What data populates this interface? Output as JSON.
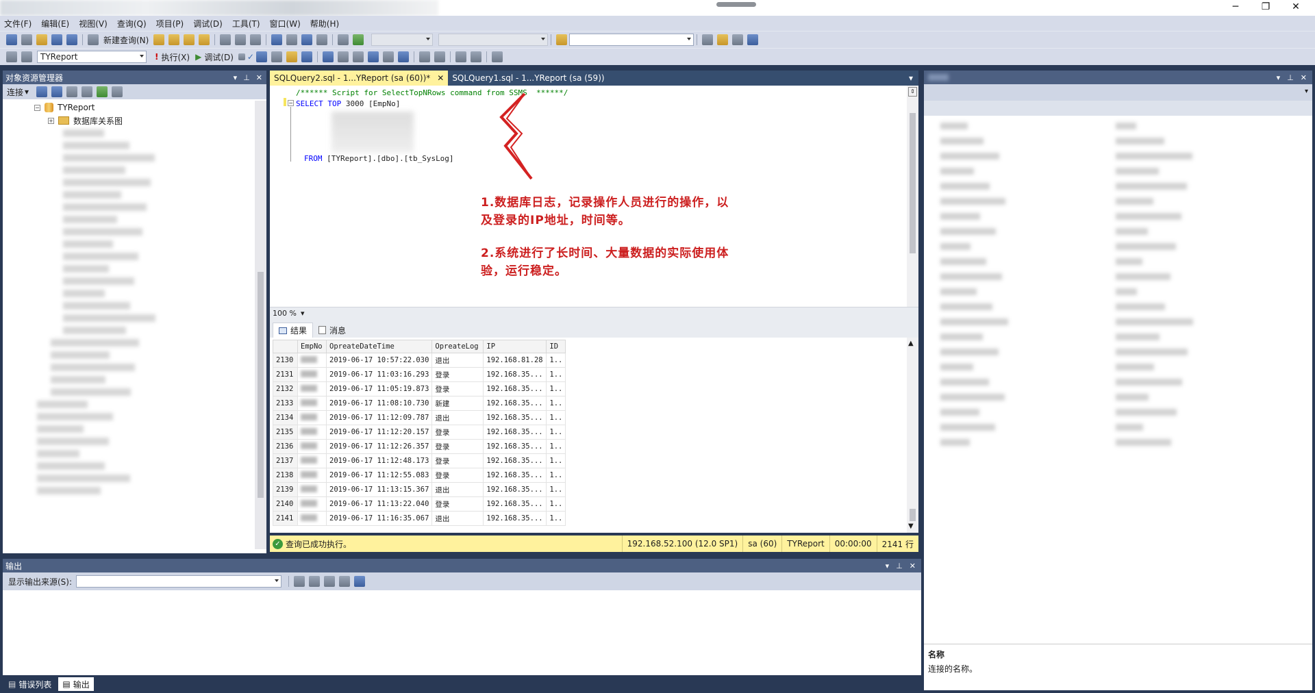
{
  "window": {
    "min_icon": "minimize-icon",
    "max_icon": "restore-icon",
    "close_icon": "close-icon",
    "min_glyph": "─",
    "max_glyph": "❐",
    "close_glyph": "✕"
  },
  "menu": [
    "文件(F)",
    "编辑(E)",
    "视图(V)",
    "查询(Q)",
    "项目(P)",
    "调试(D)",
    "工具(T)",
    "窗口(W)",
    "帮助(H)"
  ],
  "toolbar": {
    "new_query": "新建查询(N)",
    "database": "TYReport",
    "execute": "执行(X)",
    "debug": "调试(D)"
  },
  "object_explorer": {
    "title": "对象资源管理器",
    "connect": "连接",
    "db_name": "TYReport",
    "diagrams": "数据库关系图"
  },
  "tabs": [
    {
      "label": "SQLQuery2.sql - 1...YReport (sa (60))*",
      "active": true
    },
    {
      "label": "SQLQuery1.sql - 1...YReport (sa (59))",
      "active": false
    }
  ],
  "editor": {
    "line1": "/****** Script for SelectTopNRows command from SSMS  ******/",
    "line2_kw": "SELECT TOP",
    "line2_rest": " 3000 [EmpNo]",
    "line_from_kw": "FROM",
    "line_from_rest": " [TYReport].[dbo].[tb_SysLog]"
  },
  "annotation": {
    "p1_line1": "1.数据库日志，记录操作人员进行的操作，以",
    "p1_line2": "及登录的IP地址，时间等。",
    "p2_line1": "2.系统进行了长时间、大量数据的实际使用体",
    "p2_line2": "验，运行稳定。"
  },
  "zoom": "100 %",
  "results": {
    "tab_results": "结果",
    "tab_messages": "消息",
    "columns": [
      "EmpNo",
      "OpreateDateTime",
      "OpreateLog",
      "IP",
      "ID"
    ],
    "rows": [
      {
        "n": "2130",
        "dt": "2019-06-17 10:57:22.030",
        "log": "退出",
        "ip": "192.168.81.28",
        "id": "1.."
      },
      {
        "n": "2131",
        "dt": "2019-06-17 11:03:16.293",
        "log": "登录",
        "ip": "192.168.35...",
        "id": "1.."
      },
      {
        "n": "2132",
        "dt": "2019-06-17 11:05:19.873",
        "log": "登录",
        "ip": "192.168.35...",
        "id": "1.."
      },
      {
        "n": "2133",
        "dt": "2019-06-17 11:08:10.730",
        "log": "新建",
        "ip": "192.168.35...",
        "id": "1.."
      },
      {
        "n": "2134",
        "dt": "2019-06-17 11:12:09.787",
        "log": "退出",
        "ip": "192.168.35...",
        "id": "1.."
      },
      {
        "n": "2135",
        "dt": "2019-06-17 11:12:20.157",
        "log": "登录",
        "ip": "192.168.35...",
        "id": "1.."
      },
      {
        "n": "2136",
        "dt": "2019-06-17 11:12:26.357",
        "log": "登录",
        "ip": "192.168.35...",
        "id": "1.."
      },
      {
        "n": "2137",
        "dt": "2019-06-17 11:12:48.173",
        "log": "登录",
        "ip": "192.168.35...",
        "id": "1.."
      },
      {
        "n": "2138",
        "dt": "2019-06-17 11:12:55.083",
        "log": "登录",
        "ip": "192.168.35...",
        "id": "1.."
      },
      {
        "n": "2139",
        "dt": "2019-06-17 11:13:15.367",
        "log": "退出",
        "ip": "192.168.35...",
        "id": "1.."
      },
      {
        "n": "2140",
        "dt": "2019-06-17 11:13:22.040",
        "log": "登录",
        "ip": "192.168.35...",
        "id": "1.."
      },
      {
        "n": "2141",
        "dt": "2019-06-17 11:16:35.067",
        "log": "退出",
        "ip": "192.168.35...",
        "id": "1.."
      }
    ]
  },
  "status": {
    "message": "查询已成功执行。",
    "server": "192.168.52.100 (12.0 SP1)",
    "user": "sa (60)",
    "db": "TYReport",
    "time": "00:00:00",
    "rows": "2141 行"
  },
  "output": {
    "title": "输出",
    "source_label": "显示输出来源(S):"
  },
  "bottom_tabs": [
    "错误列表",
    "输出"
  ],
  "properties": {
    "desc_title": "名称",
    "desc_text": "连接的名称。"
  },
  "colors": {
    "accent_header": "#4d6082",
    "status_yellow": "#fff29d",
    "annotation_red": "#cc1f1f",
    "shell": "#293955"
  }
}
